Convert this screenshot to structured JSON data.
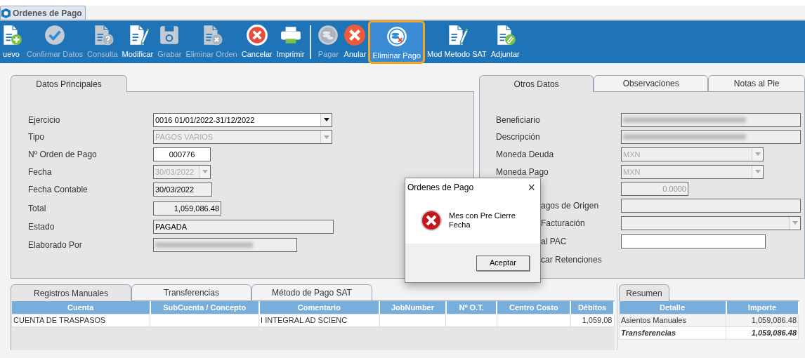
{
  "window": {
    "title": "Ordenes de Pago"
  },
  "toolbar": [
    {
      "label": "uevo",
      "kind": "new",
      "enabled": true,
      "selected": false
    },
    {
      "label": "Confirmar Datos",
      "kind": "confirm",
      "enabled": false,
      "selected": false
    },
    {
      "label": "Consulta",
      "kind": "query",
      "enabled": false,
      "selected": false
    },
    {
      "label": "Modificar",
      "kind": "edit",
      "enabled": true,
      "selected": false
    },
    {
      "label": "Grabar",
      "kind": "save",
      "enabled": false,
      "selected": false
    },
    {
      "label": "Eliminar Orden",
      "kind": "delete-doc",
      "enabled": false,
      "selected": false
    },
    {
      "label": "Cancelar",
      "kind": "cancel",
      "enabled": true,
      "selected": false
    },
    {
      "label": "Imprimir",
      "kind": "print",
      "enabled": true,
      "selected": false
    },
    {
      "kind": "separator"
    },
    {
      "label": "Pagar",
      "kind": "pay",
      "enabled": false,
      "selected": false
    },
    {
      "label": "Anular",
      "kind": "void",
      "enabled": true,
      "selected": false
    },
    {
      "label": "Eliminar Pago",
      "kind": "delete-pay",
      "enabled": true,
      "selected": true
    },
    {
      "label": "Mod Metodo SAT",
      "kind": "edit",
      "enabled": true,
      "selected": false
    },
    {
      "label": "Adjuntar",
      "kind": "attach",
      "enabled": true,
      "selected": false
    }
  ],
  "main_panel": {
    "tabs": [
      {
        "label": "Datos Principales",
        "selected": true
      }
    ],
    "fields": [
      {
        "label": "Ejercicio",
        "kind": "select",
        "value": "0016 01/01/2022-31/12/2022",
        "disabled": false
      },
      {
        "label": "Tipo",
        "kind": "select",
        "value": "PAGOS VARIOS",
        "disabled": true
      },
      {
        "label": "Nº Orden de Pago",
        "kind": "text",
        "value": "000776",
        "disabled": false
      },
      {
        "label": "Fecha",
        "kind": "select",
        "value": "30/03/2022",
        "disabled": true
      },
      {
        "label": "Fecha Contable",
        "kind": "text",
        "value": "30/03/2022",
        "disabled": true
      },
      {
        "label": "Total",
        "kind": "text",
        "value": "1,059,086.48",
        "disabled": true
      },
      {
        "label": "Estado",
        "kind": "text",
        "value": "PAGADA",
        "disabled": true
      },
      {
        "label": "Elaborado Por",
        "kind": "redacted"
      }
    ]
  },
  "side_panel": {
    "tabs": [
      {
        "label": "Otros Datos",
        "selected": true
      },
      {
        "label": "Observaciones",
        "selected": false
      },
      {
        "label": "Notas al Pie",
        "selected": false
      }
    ],
    "fields": [
      {
        "label": "Beneficiario",
        "kind": "redacted"
      },
      {
        "label": "Descripción",
        "kind": "redacted"
      },
      {
        "label": "Moneda Deuda",
        "kind": "select",
        "value": "MXN",
        "disabled": true
      },
      {
        "label": "Moneda Pago",
        "kind": "select",
        "value": "MXN",
        "disabled": true
      },
      {
        "kind": "text",
        "value": "0.0000",
        "disabled": true
      },
      {
        "label": "agos de Origen",
        "kind": "text",
        "disabled": true,
        "covered": true
      },
      {
        "label": "Facturación",
        "kind": "select",
        "disabled": true,
        "covered": true
      },
      {
        "label": "al PAC",
        "kind": "text",
        "disabled": false,
        "covered": true
      },
      {
        "label": "car Retenciones",
        "kind": "none",
        "covered": true
      }
    ]
  },
  "records": {
    "tabs": [
      {
        "label": "Registros Manuales",
        "selected": true
      },
      {
        "label": "Transferencias",
        "selected": false
      },
      {
        "label": "Método de Pago SAT",
        "selected": false
      }
    ],
    "columns": [
      "Cuenta",
      "SubCuenta / Concepto",
      "Comentario",
      "JobNumber",
      "Nº O.T.",
      "Centro Costo",
      "Débitos"
    ],
    "rows": [
      [
        "CUENTA DE TRASPASOS",
        "",
        "I INTEGRAL AD SCIENC",
        "",
        "",
        "",
        "1,059,08"
      ]
    ]
  },
  "summary": {
    "tabs": [
      {
        "label": "Resumen",
        "selected": true
      }
    ],
    "columns": [
      "Detalle",
      "Importe"
    ],
    "rows": [
      {
        "cells": [
          "Asientos Manuales",
          "1,059,086.48"
        ],
        "emphasis": false
      },
      {
        "cells": [
          "Transferencias",
          "1,059,086.48"
        ],
        "emphasis": true
      }
    ]
  },
  "dialog": {
    "title": "Ordenes de Pago",
    "close": "×",
    "message": "Mes con Pre Cierre Fecha",
    "button": "Aceptar"
  }
}
